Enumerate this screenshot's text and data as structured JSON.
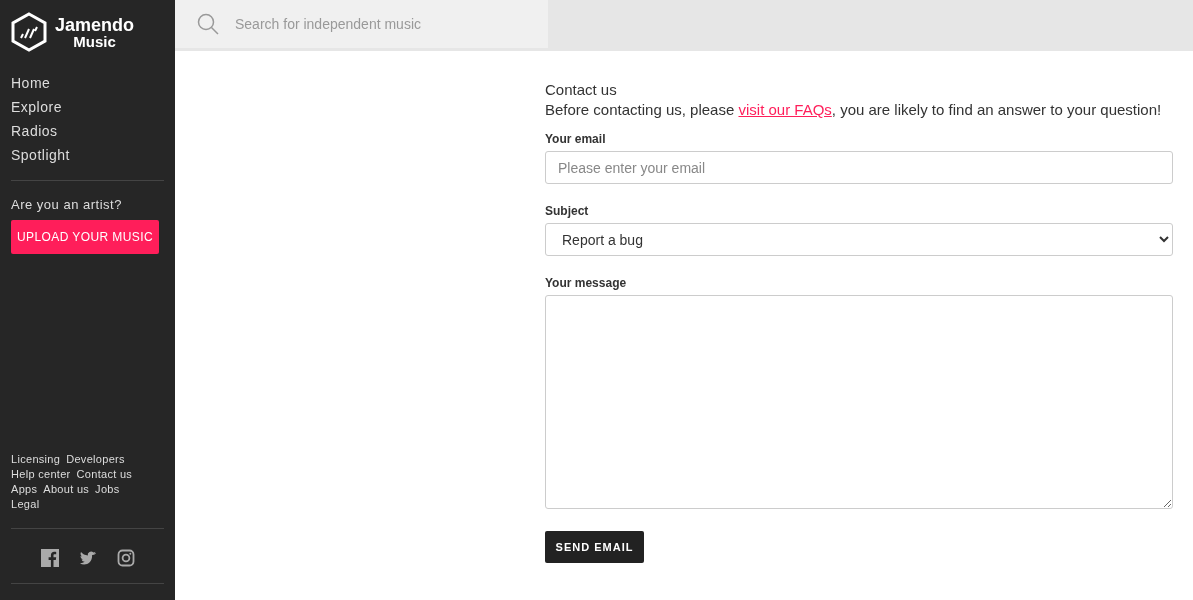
{
  "sidebar": {
    "logo": {
      "line_1": "Jamendo",
      "line_2": "Music"
    },
    "nav": [
      {
        "label": "Home"
      },
      {
        "label": "Explore"
      },
      {
        "label": "Radios"
      },
      {
        "label": "Spotlight"
      }
    ],
    "artist_prompt": "Are you an artist?",
    "upload_button": "UPLOAD YOUR MUSIC",
    "footer_links": [
      [
        "Licensing",
        "Developers"
      ],
      [
        "Help center",
        "Contact us"
      ],
      [
        "Apps",
        "About us",
        "Jobs"
      ],
      [
        "Legal"
      ]
    ]
  },
  "search": {
    "placeholder": "Search for independent music"
  },
  "form": {
    "title": "Contact us",
    "intro_before": "Before contacting us, please ",
    "faq_link": "visit our FAQs",
    "intro_after": ", you are likely to find an answer to your question!",
    "email_label": "Your email",
    "email_placeholder": "Please enter your email",
    "subject_label": "Subject",
    "subject_value": "Report a bug",
    "message_label": "Your message",
    "send_button": "SEND EMAIL"
  }
}
